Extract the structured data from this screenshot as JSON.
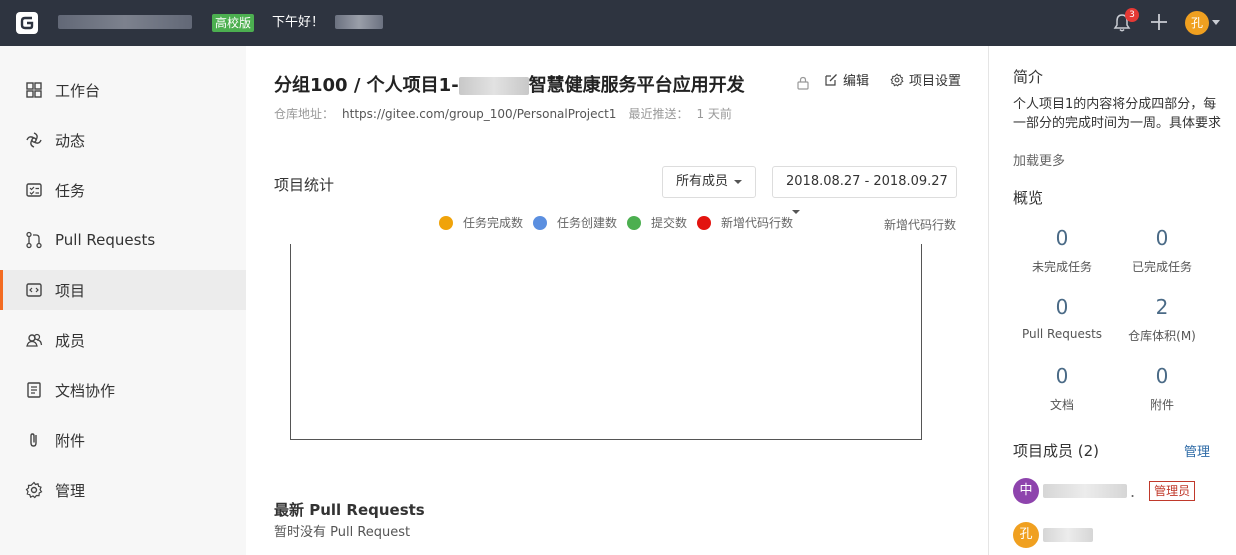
{
  "topbar": {
    "edition_badge": "高校版",
    "greeting": "下午好！",
    "notification_count": "3",
    "avatar_char": "孔"
  },
  "sidebar": {
    "items": [
      {
        "label": "工作台",
        "icon": "dashboard-icon"
      },
      {
        "label": "动态",
        "icon": "activity-icon"
      },
      {
        "label": "任务",
        "icon": "task-icon"
      },
      {
        "label": "Pull Requests",
        "icon": "pull-request-icon"
      },
      {
        "label": "项目",
        "icon": "code-icon",
        "active": true
      },
      {
        "label": "成员",
        "icon": "members-icon"
      },
      {
        "label": " 文档协作",
        "icon": "document-icon"
      },
      {
        "label": "附件",
        "icon": "attachment-icon"
      },
      {
        "label": "管理",
        "icon": "gear-icon"
      }
    ]
  },
  "main": {
    "title_prefix": "分组100 / 个人项目1-",
    "title_suffix": "智慧健康服务平台应用开发",
    "edit_label": "编辑",
    "settings_label": "项目设置",
    "repo_label": "仓库地址：",
    "repo_url": "https://gitee.com/group_100/PersonalProject1",
    "push_label": "最近推送：",
    "push_value": "1 天前",
    "stats_title": "项目统计",
    "member_filter": "所有成员",
    "date_range": "2018.08.27 - 2018.09.27",
    "right_axis_label": "新增代码行数",
    "pr_title": "最新 Pull Requests",
    "pr_empty": "暂时没有 Pull Request"
  },
  "chart_data": {
    "type": "line",
    "series": [
      {
        "name": "任务完成数",
        "color": "#f0a30a",
        "values": []
      },
      {
        "name": "任务创建数",
        "color": "#5b8fe0",
        "values": []
      },
      {
        "name": "提交数",
        "color": "#4caf50",
        "values": []
      },
      {
        "name": "新增代码行数",
        "color": "#e3140f",
        "values": []
      }
    ],
    "y2label": "新增代码行数"
  },
  "rpanel": {
    "intro_heading": "简介",
    "intro_text": "个人项目1的内容将分成四部分，每一部分的完成时间为一周。具体要求可查阅readme文...",
    "load_more": "加载更多",
    "overview_heading": "概览",
    "stats": [
      {
        "value": "0",
        "label": "未完成任务"
      },
      {
        "value": "0",
        "label": "已完成任务"
      },
      {
        "value": "0",
        "label": "Pull Requests"
      },
      {
        "value": "2",
        "label": "仓库体积(M)"
      },
      {
        "value": "0",
        "label": "文档"
      },
      {
        "value": "0",
        "label": "附件"
      }
    ],
    "members_heading": "项目成员 (2)",
    "manage_label": "管理",
    "members": [
      {
        "avatar": "中",
        "color": "#8e44ad",
        "role": "管理员"
      },
      {
        "avatar": "孔",
        "color": "#f0a020",
        "role": ""
      }
    ]
  }
}
